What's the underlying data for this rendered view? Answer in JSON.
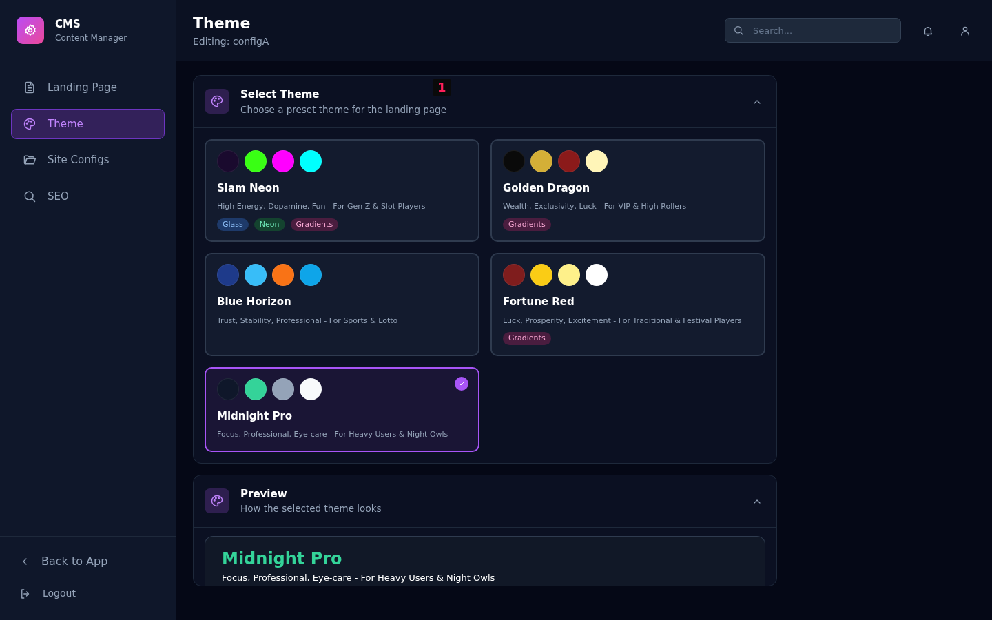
{
  "brand": {
    "title": "CMS",
    "subtitle": "Content Manager"
  },
  "nav": [
    {
      "label": "Landing Page",
      "selected": false
    },
    {
      "label": "Theme",
      "selected": true
    },
    {
      "label": "Site Configs",
      "selected": false
    },
    {
      "label": "SEO",
      "selected": false
    }
  ],
  "sidebar_footer": [
    {
      "label": "Back to App"
    },
    {
      "label": "Logout"
    }
  ],
  "header": {
    "title": "Theme",
    "subtitle": "Editing: configA",
    "search": {
      "placeholder": "Search..."
    }
  },
  "select_section": {
    "title": "Select Theme",
    "subtitle": "Choose a preset theme for the landing page",
    "badge": "1",
    "expanded": true,
    "themes": [
      {
        "name": "Siam Neon",
        "description": "High Energy, Dopamine, Fun - For Gen Z & Slot Players",
        "selected": false,
        "swatches": [
          {
            "color": "#1a0a2e"
          },
          {
            "color": "#39ff14"
          },
          {
            "color": "#ff00ff"
          },
          {
            "color": "#00ffff"
          }
        ],
        "tags": [
          {
            "label": "Glass",
            "kind": "glass"
          },
          {
            "label": "Neon",
            "kind": "neon"
          },
          {
            "label": "Gradients",
            "kind": "gradients"
          }
        ]
      },
      {
        "name": "Golden Dragon",
        "description": "Wealth, Exclusivity, Luck - For VIP & High Rollers",
        "selected": false,
        "swatches": [
          {
            "color": "#0a0a0a"
          },
          {
            "color": "#d4af37"
          },
          {
            "color": "#8b1a1a"
          },
          {
            "color": "#fff5b8"
          }
        ],
        "tags": [
          {
            "label": "Gradients",
            "kind": "gradients"
          }
        ]
      },
      {
        "name": "Blue Horizon",
        "description": "Trust, Stability, Professional - For Sports & Lotto",
        "selected": false,
        "swatches": [
          {
            "color": "#1e3a8a"
          },
          {
            "color": "#38bdf8"
          },
          {
            "color": "#f97316"
          },
          {
            "color": "#0ea5e9"
          }
        ]
      },
      {
        "name": "Fortune Red",
        "description": "Luck, Prosperity, Excitement - For Traditional & Festival Players",
        "selected": false,
        "swatches": [
          {
            "color": "#7f1d1d"
          },
          {
            "color": "#facc15"
          },
          {
            "color": "#fef08a"
          },
          {
            "color": "#ffffff"
          }
        ],
        "tags": [
          {
            "label": "Gradients",
            "kind": "gradients"
          }
        ]
      },
      {
        "name": "Midnight Pro",
        "description": "Focus, Professional, Eye-care - For Heavy Users & Night Owls",
        "selected": true,
        "swatches": [
          {
            "color": "#0f172a"
          },
          {
            "color": "#34d399"
          },
          {
            "color": "#94a3b8"
          },
          {
            "color": "#f8fafc"
          }
        ]
      }
    ]
  },
  "preview_section": {
    "title": "Preview",
    "subtitle": "How the selected theme looks",
    "expanded": true,
    "theme_name": "Midnight Pro",
    "theme_description": "Focus, Professional, Eye-care - For Heavy Users & Night Owls"
  }
}
